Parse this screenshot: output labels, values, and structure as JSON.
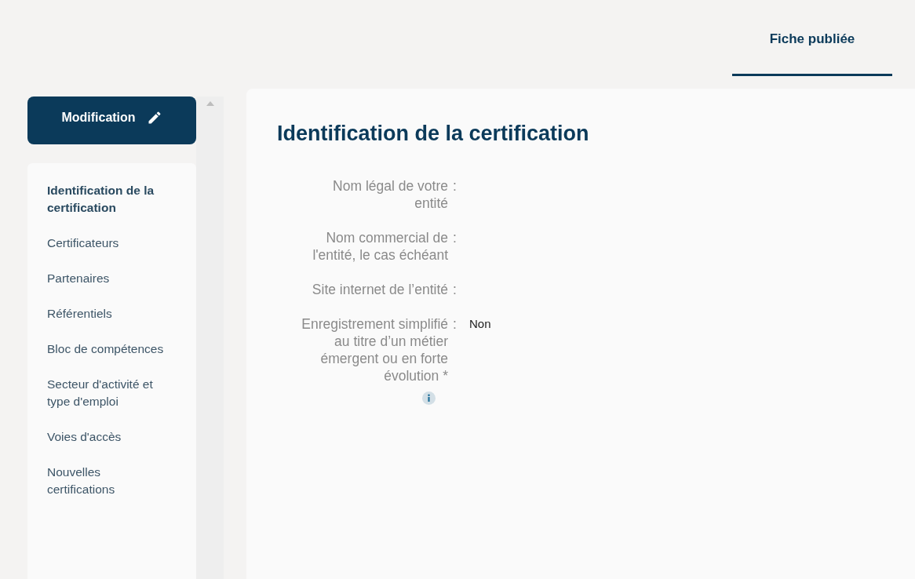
{
  "tabs": [
    {
      "label": "Fiche publiée",
      "selected": true
    }
  ],
  "edit_button": {
    "label": "Modification"
  },
  "sidebar": {
    "items": [
      {
        "label": "Identification de la certification",
        "selected": true
      },
      {
        "label": "Certificateurs",
        "selected": false
      },
      {
        "label": "Partenaires",
        "selected": false
      },
      {
        "label": "Référentiels",
        "selected": false
      },
      {
        "label": "Bloc de compétences",
        "selected": false
      },
      {
        "label": "Secteur d'activité et type d'emploi",
        "selected": false
      },
      {
        "label": "Voies d'accès",
        "selected": false
      },
      {
        "label": "Nouvelles certifications",
        "selected": false
      }
    ]
  },
  "section": {
    "title": "Identification de la certification",
    "separator": ":",
    "fields": [
      {
        "label": "Nom légal de votre entité",
        "info": false
      },
      {
        "label": "Nom commercial de l'entité, le cas échéant",
        "info": false
      },
      {
        "label": "Site internet de l’entité",
        "info": false
      },
      {
        "label": "Enregistrement simplifié au titre d’un métier émergent ou en forte évolution *",
        "value": "Non",
        "info": true
      }
    ]
  }
}
